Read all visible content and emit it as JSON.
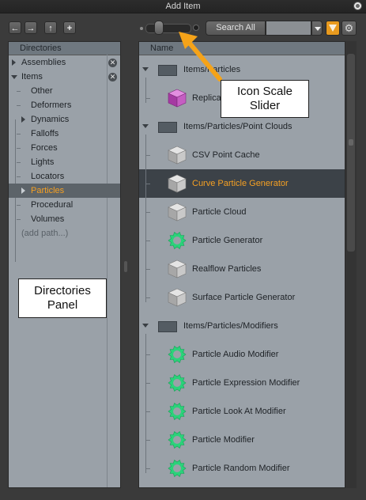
{
  "window": {
    "title": "Add Item"
  },
  "toolbar": {
    "back_label": "←",
    "forward_label": "→",
    "up_label": "↑",
    "add_label": "+",
    "search_mode": "Search All",
    "search_value": "",
    "icon_scale_level": 0.2,
    "filter_color": "#e89a1e"
  },
  "directories": {
    "header": "Directories",
    "items": [
      {
        "label": "Assemblies",
        "expandable": true
      },
      {
        "label": "Items",
        "expandable": true,
        "expanded": true
      },
      {
        "label": "Other"
      },
      {
        "label": "Deformers"
      },
      {
        "label": "Dynamics",
        "expandable": true
      },
      {
        "label": "Falloffs"
      },
      {
        "label": "Forces"
      },
      {
        "label": "Lights"
      },
      {
        "label": "Locators"
      },
      {
        "label": "Particles",
        "expandable": true,
        "selected": true
      },
      {
        "label": "Procedural"
      },
      {
        "label": "Volumes"
      },
      {
        "label": "(add path...)"
      }
    ]
  },
  "items_list": {
    "header": "Name",
    "rows": [
      {
        "label": "Items/Particles",
        "type": "folder"
      },
      {
        "label": "Replicator",
        "type": "cube-purple"
      },
      {
        "label": "Items/Particles/Point Clouds",
        "type": "folder"
      },
      {
        "label": "CSV Point Cache",
        "type": "cube"
      },
      {
        "label": "Curve Particle Generator",
        "type": "cube",
        "selected": true
      },
      {
        "label": "Particle Cloud",
        "type": "cube"
      },
      {
        "label": "Particle Generator",
        "type": "gear"
      },
      {
        "label": "Realflow Particles",
        "type": "cube"
      },
      {
        "label": "Surface Particle Generator",
        "type": "cube"
      },
      {
        "label": "Items/Particles/Modifiers",
        "type": "folder"
      },
      {
        "label": "Particle Audio Modifier",
        "type": "gear"
      },
      {
        "label": "Particle Expression Modifier",
        "type": "gear"
      },
      {
        "label": "Particle Look At Modifier",
        "type": "gear"
      },
      {
        "label": "Particle Modifier",
        "type": "gear"
      },
      {
        "label": "Particle Random Modifier",
        "type": "gear"
      }
    ]
  },
  "annotations": {
    "icon_scale": "Icon Scale Slider",
    "directories_panel": "Directories Panel",
    "arrow_color": "#f5a319"
  }
}
